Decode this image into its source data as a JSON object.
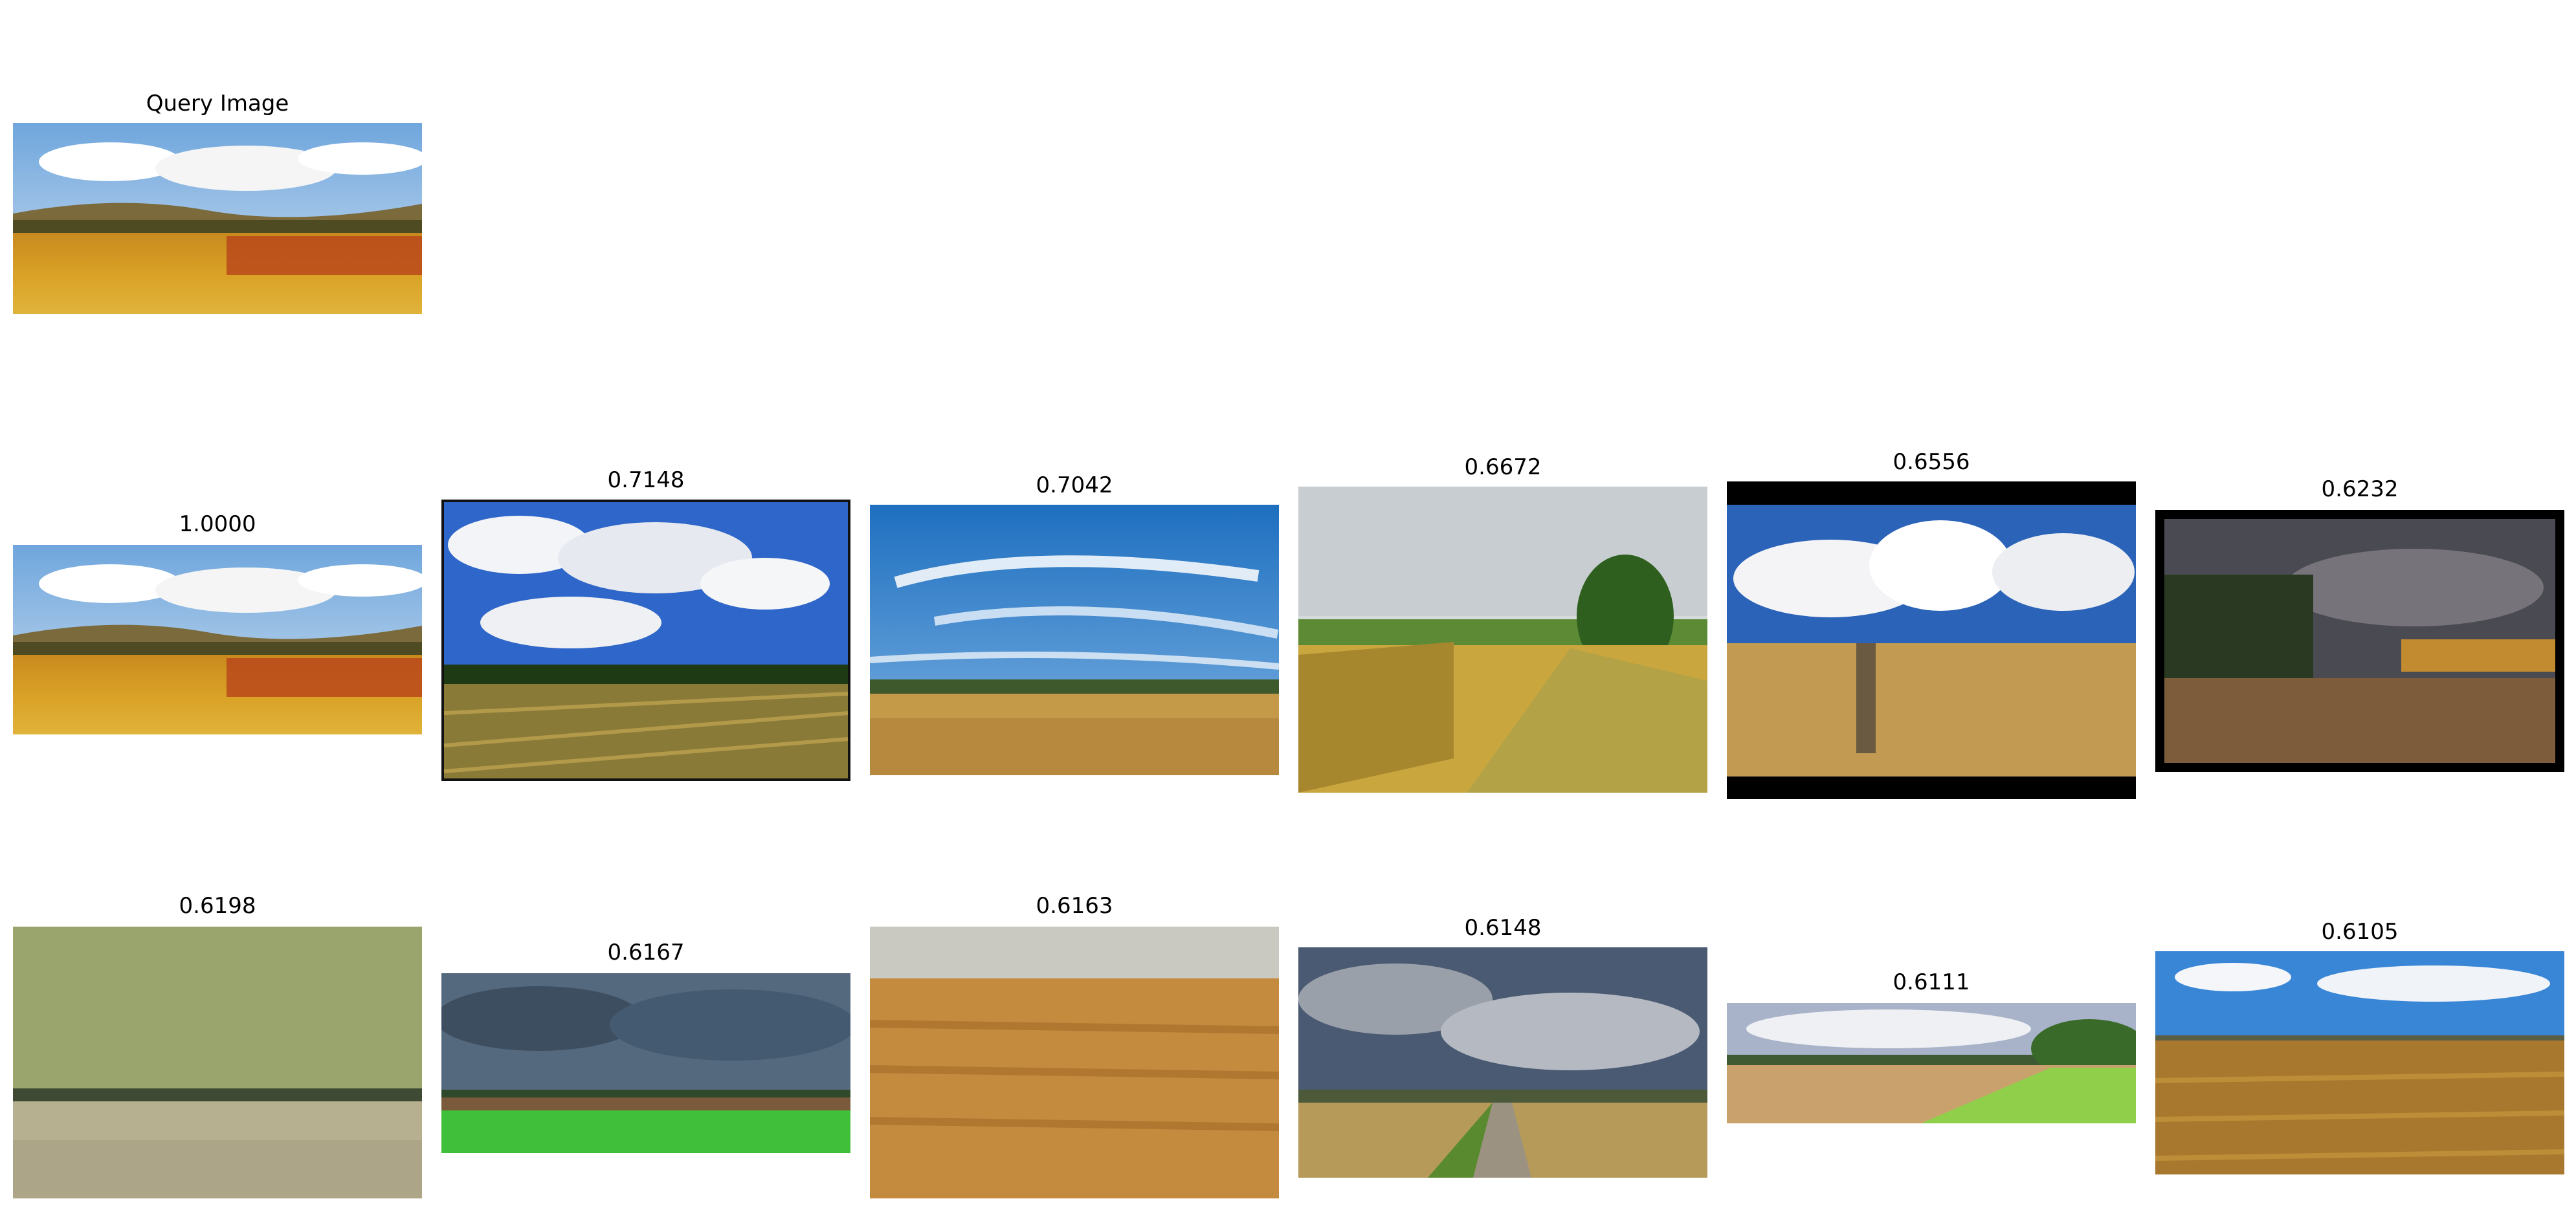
{
  "query": {
    "title": "Query Image"
  },
  "results": [
    {
      "score": "1.0000"
    },
    {
      "score": "0.7148"
    },
    {
      "score": "0.7042"
    },
    {
      "score": "0.6672"
    },
    {
      "score": "0.6556"
    },
    {
      "score": "0.6232"
    },
    {
      "score": "0.6198"
    },
    {
      "score": "0.6167"
    },
    {
      "score": "0.6163"
    },
    {
      "score": "0.6148"
    },
    {
      "score": "0.6111"
    },
    {
      "score": "0.6105"
    }
  ]
}
